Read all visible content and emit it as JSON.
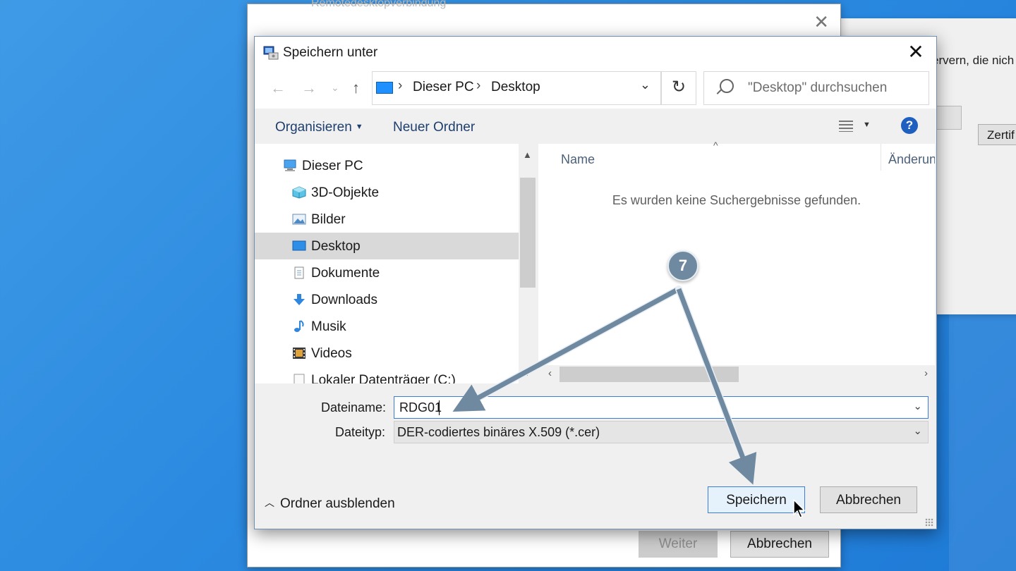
{
  "background_window_right": {
    "text": "ervern, die nich",
    "button_label": "Zertif"
  },
  "background_window": {
    "title": "Remotedesktopverbindung",
    "next_label": "Weiter",
    "cancel_label": "Abbrechen"
  },
  "dialog": {
    "title": "Speichern unter",
    "breadcrumb": [
      "Dieser PC",
      "Desktop"
    ],
    "search_placeholder": "\"Desktop\" durchsuchen",
    "toolbar": {
      "organize": "Organisieren",
      "new_folder": "Neuer Ordner"
    },
    "nav_items": [
      {
        "label": "Dieser PC",
        "icon": "computer-icon"
      },
      {
        "label": "3D-Objekte",
        "icon": "cube-icon"
      },
      {
        "label": "Bilder",
        "icon": "pictures-icon"
      },
      {
        "label": "Desktop",
        "icon": "desktop-icon",
        "selected": true
      },
      {
        "label": "Dokumente",
        "icon": "documents-icon"
      },
      {
        "label": "Downloads",
        "icon": "download-icon"
      },
      {
        "label": "Musik",
        "icon": "music-icon"
      },
      {
        "label": "Videos",
        "icon": "video-icon"
      },
      {
        "label": "Lokaler Datenträger (C:)",
        "icon": "drive-icon"
      }
    ],
    "columns": {
      "name": "Name",
      "changed": "Änderungsdatum"
    },
    "empty_message": "Es wurden keine Suchergebnisse gefunden.",
    "filename_label": "Dateiname:",
    "filename_value": "RDG01",
    "filetype_label": "Dateityp:",
    "filetype_value": "DER-codiertes binäres X.509 (*.cer)",
    "hide_folders": "Ordner ausblenden",
    "save_label": "Speichern",
    "cancel_label": "Abbrechen"
  },
  "annotation": {
    "step_number": "7",
    "color": "#6f8aa0"
  }
}
